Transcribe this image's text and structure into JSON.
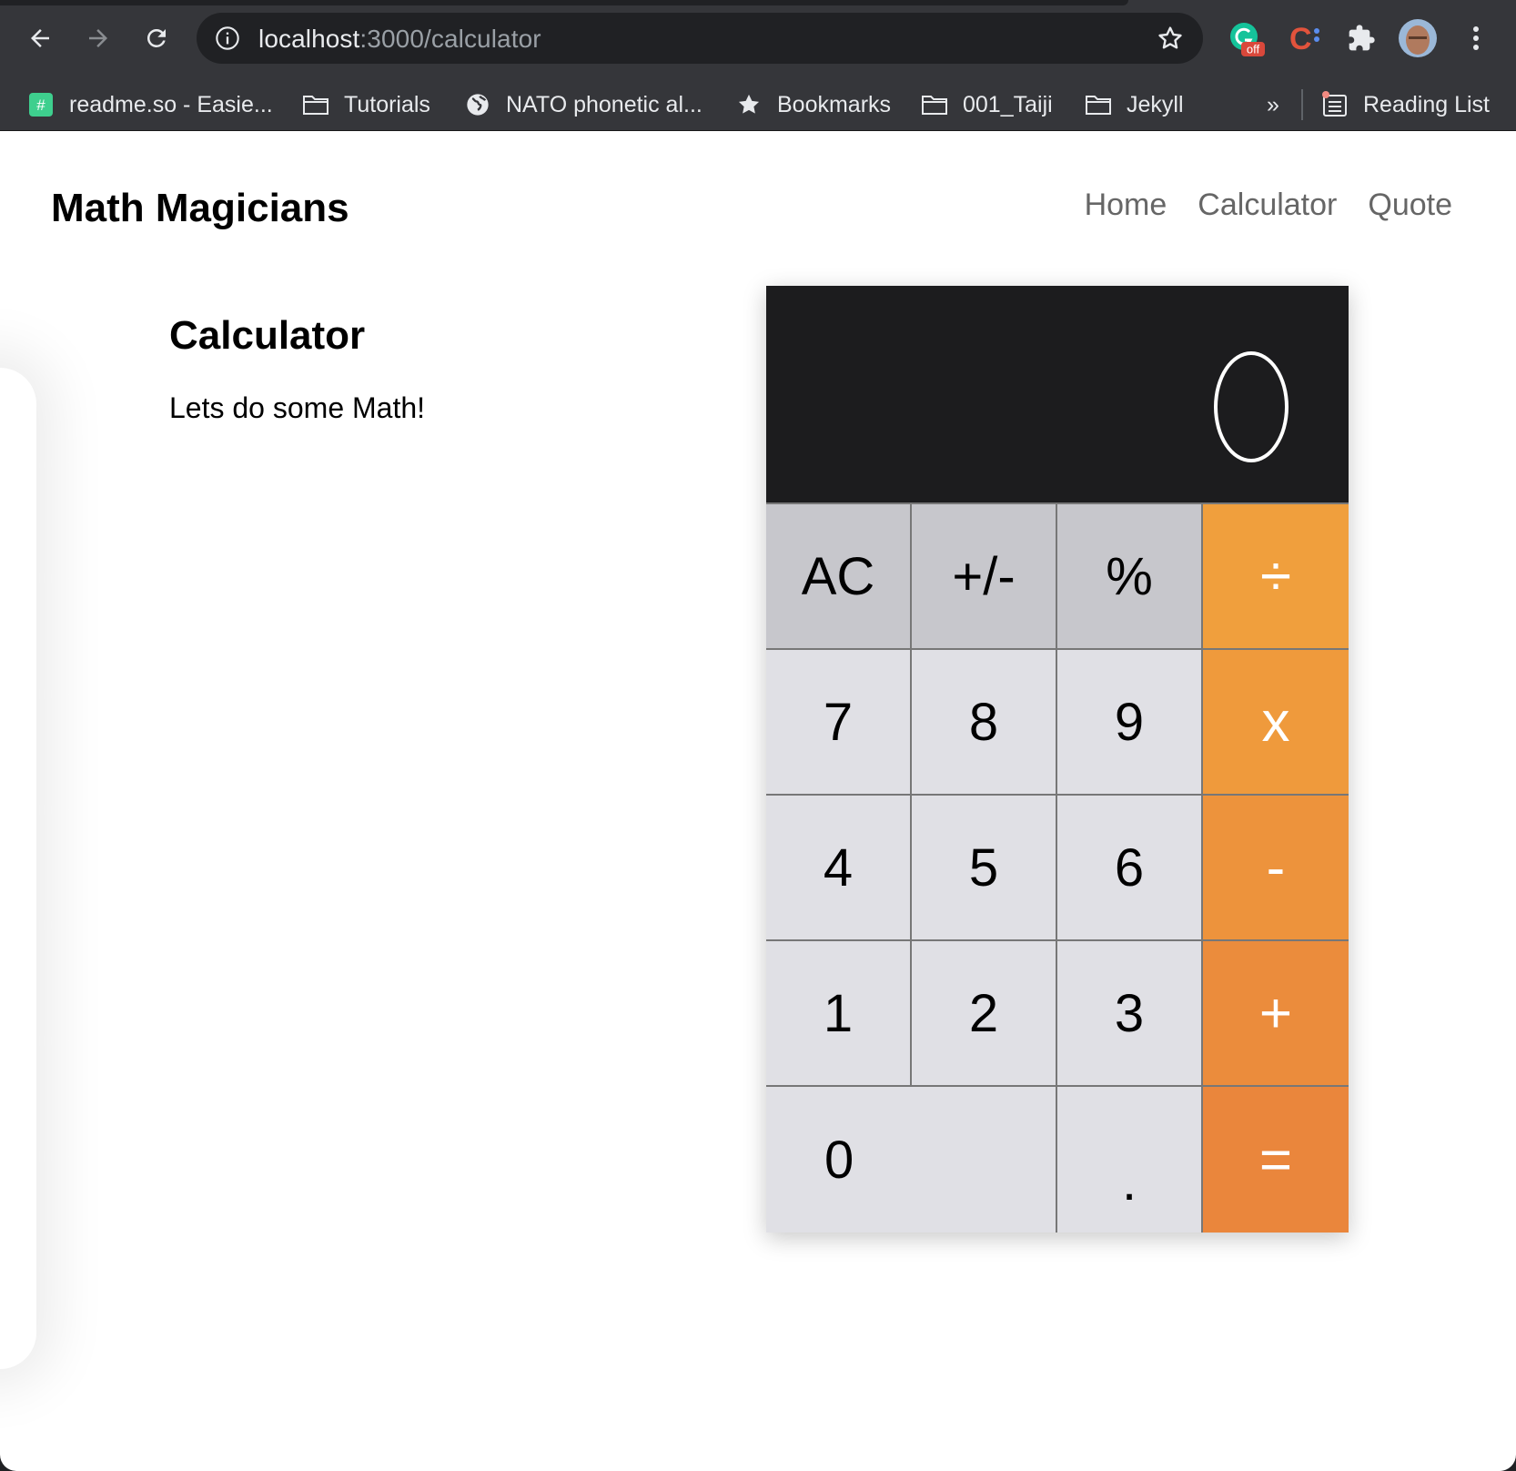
{
  "browser": {
    "url_host": "localhost",
    "url_path": ":3000/calculator",
    "extension_badge": "off",
    "bookmarks": [
      {
        "label": "readme.so - Easie...",
        "icon": "hash-icon"
      },
      {
        "label": "Tutorials",
        "icon": "folder-icon"
      },
      {
        "label": "NATO phonetic al...",
        "icon": "globe-icon"
      },
      {
        "label": "Bookmarks",
        "icon": "star-icon"
      },
      {
        "label": "001_Taiji",
        "icon": "folder-icon"
      },
      {
        "label": "Jekyll",
        "icon": "folder-icon"
      }
    ],
    "overflow_label": "»",
    "reading_list_label": "Reading List"
  },
  "header": {
    "brand": "Math Magicians",
    "nav": [
      "Home",
      "Calculator",
      "Quote"
    ]
  },
  "main": {
    "heading": "Calculator",
    "intro": "Lets do some Math!"
  },
  "calculator": {
    "display": "0",
    "keys": [
      [
        "AC",
        "+/-",
        "%",
        "÷"
      ],
      [
        "7",
        "8",
        "9",
        "x"
      ],
      [
        "4",
        "5",
        "6",
        "-"
      ],
      [
        "1",
        "2",
        "3",
        "+"
      ],
      [
        "0",
        ".",
        "="
      ]
    ]
  },
  "colors": {
    "display_bg": "#1c1c1e",
    "function_key": "#c7c7cc",
    "number_key": "#e0e0e5",
    "operator_top": "#f09f3d",
    "operator_bottom": "#ea863c"
  }
}
